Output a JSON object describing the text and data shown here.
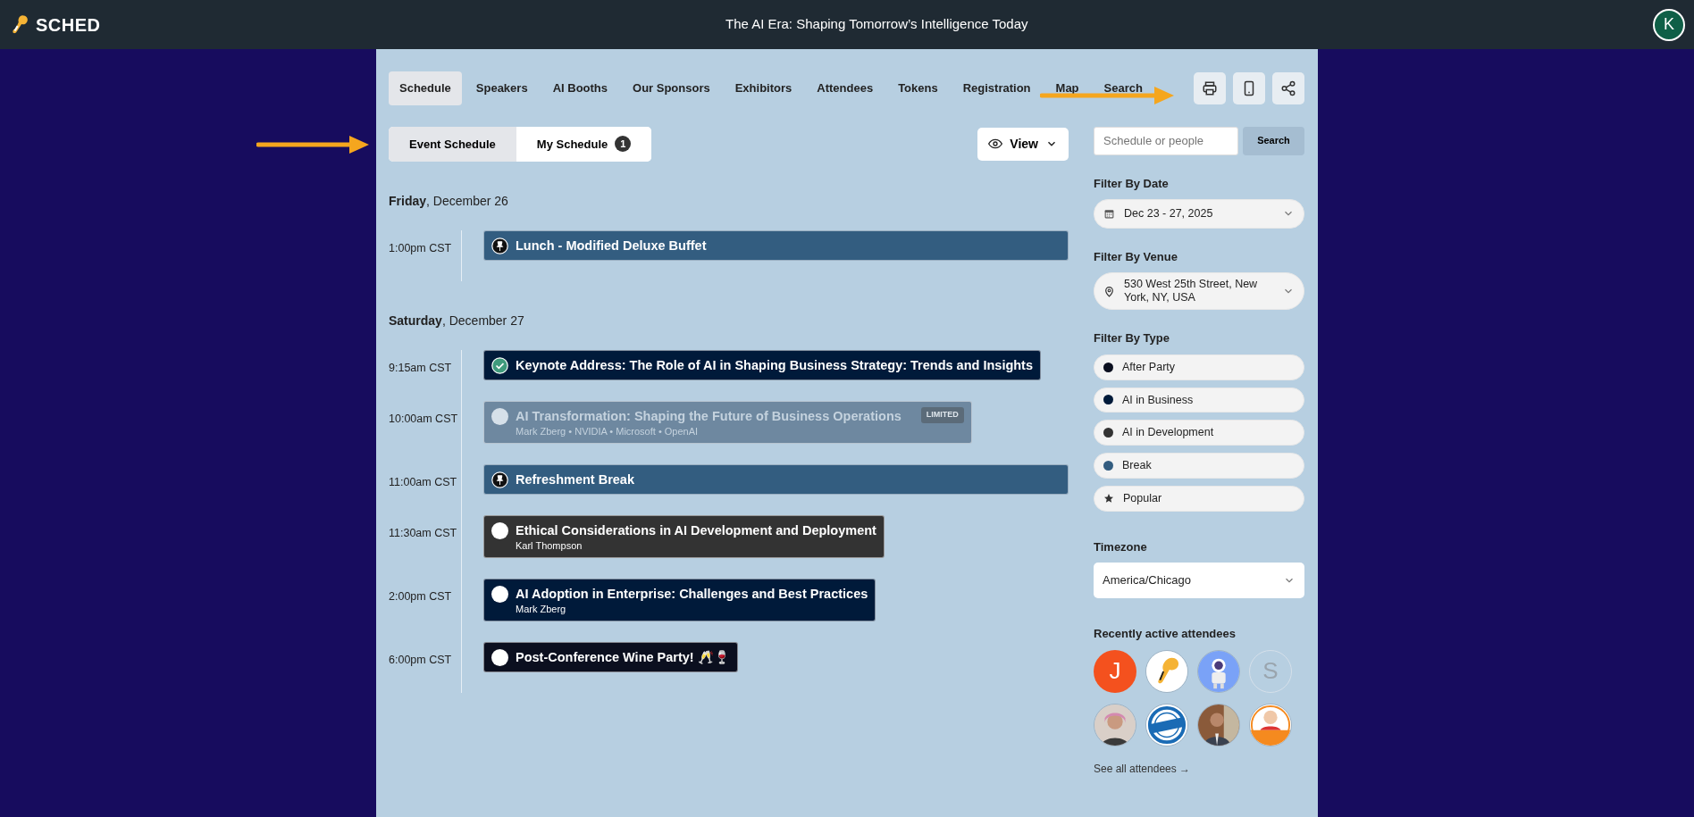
{
  "header": {
    "logo": "SCHED",
    "title": "The AI Era: Shaping Tomorrow’s Intelligence Today",
    "user_initial": "K"
  },
  "nav": [
    {
      "label": "Schedule",
      "selected": true
    },
    {
      "label": "Speakers",
      "selected": false
    },
    {
      "label": "AI Booths",
      "selected": false
    },
    {
      "label": "Our Sponsors",
      "selected": false
    },
    {
      "label": "Exhibitors",
      "selected": false
    },
    {
      "label": "Attendees",
      "selected": false
    },
    {
      "label": "Tokens",
      "selected": false
    },
    {
      "label": "Registration",
      "selected": false
    },
    {
      "label": "Map",
      "selected": false
    },
    {
      "label": "Search",
      "selected": false
    }
  ],
  "schedule_switch": [
    {
      "label": "Event Schedule",
      "selected": true
    },
    {
      "label": "My Schedule",
      "selected": false,
      "count": "1"
    }
  ],
  "view_button": "View",
  "days": [
    {
      "weekday": "Friday",
      "date": ", December 26",
      "sessions": [
        {
          "time": "1:00pm CST",
          "title": "Lunch - Modified Deluxe Buffet",
          "kind": "break",
          "color": "#335d80",
          "disabled": false
        }
      ]
    },
    {
      "weekday": "Saturday",
      "date": ", December 27",
      "sessions": [
        {
          "time": "9:15am CST",
          "title": "Keynote Address: The Role of AI in Shaping Business Strategy: Trends and Insights",
          "kind": "session",
          "color": "#001a3a",
          "added": true,
          "disabled": false
        },
        {
          "time": "10:00am CST",
          "title": "AI Transformation: Shaping the Future of Business Operations",
          "speakers": "Mark Zberg • NVIDIA • Microsoft • OpenAI",
          "badge": "LIMITED",
          "kind": "session",
          "color": "#6e88a0",
          "added": false,
          "disabled": true
        },
        {
          "time": "11:00am CST",
          "title": "Refreshment Break",
          "kind": "break",
          "color": "#335d80",
          "disabled": false
        },
        {
          "time": "11:30am CST",
          "title": "Ethical Considerations in AI Development and Deployment",
          "speakers": "Karl Thompson",
          "kind": "session",
          "color": "#333333",
          "added": false,
          "disabled": false
        },
        {
          "time": "2:00pm CST",
          "title": "AI Adoption in Enterprise: Challenges and Best Practices",
          "speakers": "Mark Zberg",
          "kind": "session",
          "color": "#001a3a",
          "added": false,
          "disabled": false
        },
        {
          "time": "6:00pm CST",
          "title": "Post-Conference Wine Party! 🥂🍷",
          "kind": "session",
          "color": "#0b0f1f",
          "added": false,
          "disabled": false
        }
      ]
    }
  ],
  "search": {
    "placeholder": "Schedule or people",
    "button": "Search"
  },
  "filter_date": {
    "label": "Filter By Date",
    "value": "Dec 23 - 27, 2025"
  },
  "filter_venue": {
    "label": "Filter By Venue",
    "value": "530 West 25th Street, New York, NY, USA"
  },
  "filter_type": {
    "label": "Filter By Type",
    "items": [
      {
        "label": "After Party",
        "kind": "dot",
        "color": "#0b0f1f"
      },
      {
        "label": "AI in Business",
        "kind": "dot",
        "color": "#001a3a"
      },
      {
        "label": "AI in Development",
        "kind": "dot",
        "color": "#333333"
      },
      {
        "label": "Break",
        "kind": "dot",
        "color": "#335d80"
      },
      {
        "label": "Popular",
        "kind": "star"
      }
    ]
  },
  "timezone": {
    "label": "Timezone",
    "value": "America/Chicago"
  },
  "attendees": {
    "label": "Recently active attendees",
    "items": [
      {
        "kind": "filled",
        "initial": "J"
      },
      {
        "kind": "picture"
      },
      {
        "kind": "picture"
      },
      {
        "kind": "outline",
        "initial": "S"
      },
      {
        "kind": "picture"
      },
      {
        "kind": "picture"
      },
      {
        "kind": "picture"
      },
      {
        "kind": "picture"
      }
    ],
    "link": "See all attendees →"
  }
}
